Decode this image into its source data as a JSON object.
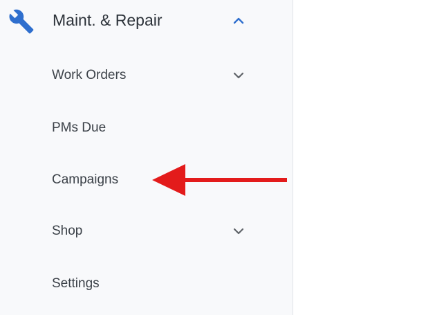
{
  "sidebar": {
    "section": {
      "title": "Maint. & Repair",
      "icon": "wrench-icon",
      "expanded": true,
      "icon_color": "#2f6fce",
      "chevron_color": "#2f6fce"
    },
    "items": [
      {
        "label": "Work Orders",
        "has_submenu": true,
        "chevron": "chevron-down-icon"
      },
      {
        "label": "PMs Due",
        "has_submenu": false
      },
      {
        "label": "Campaigns",
        "has_submenu": false
      },
      {
        "label": "Shop",
        "has_submenu": true,
        "chevron": "chevron-down-icon"
      },
      {
        "label": "Settings",
        "has_submenu": false
      }
    ]
  },
  "annotation": {
    "type": "arrow",
    "points_to": "Campaigns",
    "color": "#e31b1b"
  }
}
